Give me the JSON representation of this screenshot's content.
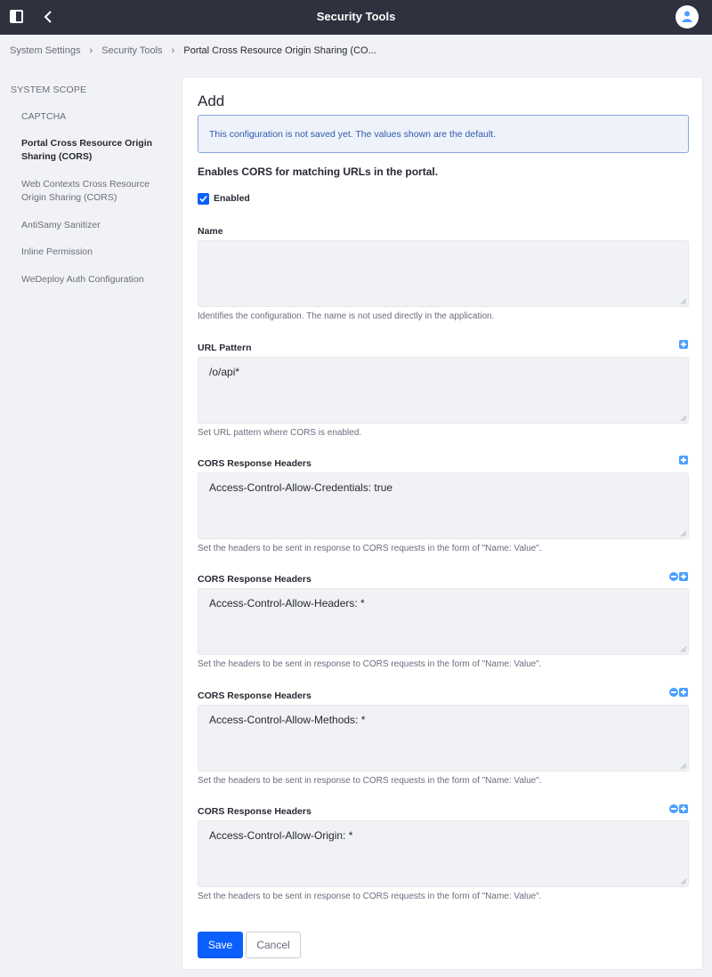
{
  "header": {
    "title": "Security Tools"
  },
  "breadcrumb": [
    "System Settings",
    "Security Tools",
    "Portal Cross Resource Origin Sharing (CO..."
  ],
  "sidebar": {
    "scope_label": "SYSTEM SCOPE",
    "items": [
      {
        "label": "CAPTCHA"
      },
      {
        "label": "Portal Cross Resource Origin Sharing (CORS)"
      },
      {
        "label": "Web Contexts Cross Resource Origin Sharing (CORS)"
      },
      {
        "label": "AntiSamy Sanitizer"
      },
      {
        "label": "Inline Permission"
      },
      {
        "label": "WeDeploy Auth Configuration"
      }
    ]
  },
  "form": {
    "heading": "Add",
    "alert": "This configuration is not saved yet. The values shown are the default.",
    "description": "Enables CORS for matching URLs in the portal.",
    "enabled_label": "Enabled",
    "name": {
      "label": "Name",
      "value": "",
      "help": "Identifies the configuration. The name is not used directly in the application."
    },
    "url_pattern": {
      "label": "URL Pattern",
      "value": "/o/api*",
      "help": "Set URL pattern where CORS is enabled."
    },
    "headers": [
      {
        "label": "CORS Response Headers",
        "value": "Access-Control-Allow-Credentials: true",
        "help": "Set the headers to be sent in response to CORS requests in the form of \"Name: Value\"."
      },
      {
        "label": "CORS Response Headers",
        "value": "Access-Control-Allow-Headers: *",
        "help": "Set the headers to be sent in response to CORS requests in the form of \"Name: Value\"."
      },
      {
        "label": "CORS Response Headers",
        "value": "Access-Control-Allow-Methods: *",
        "help": "Set the headers to be sent in response to CORS requests in the form of \"Name: Value\"."
      },
      {
        "label": "CORS Response Headers",
        "value": "Access-Control-Allow-Origin: *",
        "help": "Set the headers to be sent in response to CORS requests in the form of \"Name: Value\"."
      }
    ],
    "save_label": "Save",
    "cancel_label": "Cancel"
  },
  "colors": {
    "header_bg": "#30313f",
    "primary": "#0b5fff",
    "alert_bg": "#eef2fa",
    "alert_text": "#2e5aac"
  }
}
